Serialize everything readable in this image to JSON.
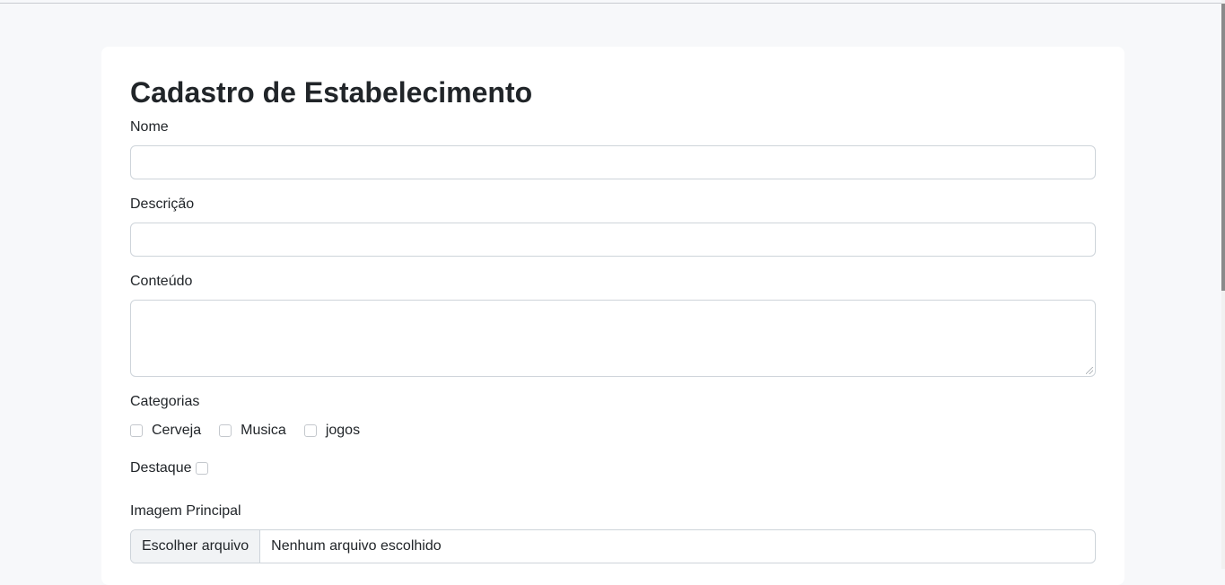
{
  "form": {
    "title": "Cadastro de Estabelecimento",
    "nome": {
      "label": "Nome",
      "value": "",
      "placeholder": ""
    },
    "descricao": {
      "label": "Descrição",
      "value": "",
      "placeholder": ""
    },
    "conteudo": {
      "label": "Conteúdo",
      "value": "",
      "placeholder": ""
    },
    "categorias": {
      "label": "Categorias",
      "options": [
        {
          "label": "Cerveja",
          "checked": false
        },
        {
          "label": "Musica",
          "checked": false
        },
        {
          "label": "jogos",
          "checked": false
        }
      ]
    },
    "destaque": {
      "label": "Destaque",
      "checked": false
    },
    "imagem_principal": {
      "label": "Imagem Principal",
      "button_label": "Escolher arquivo",
      "status": "Nenhum arquivo escolhido"
    }
  },
  "colors": {
    "page_background": "#f7f8fa",
    "card_background": "#ffffff",
    "input_border": "#ced4da",
    "text": "#212529"
  }
}
